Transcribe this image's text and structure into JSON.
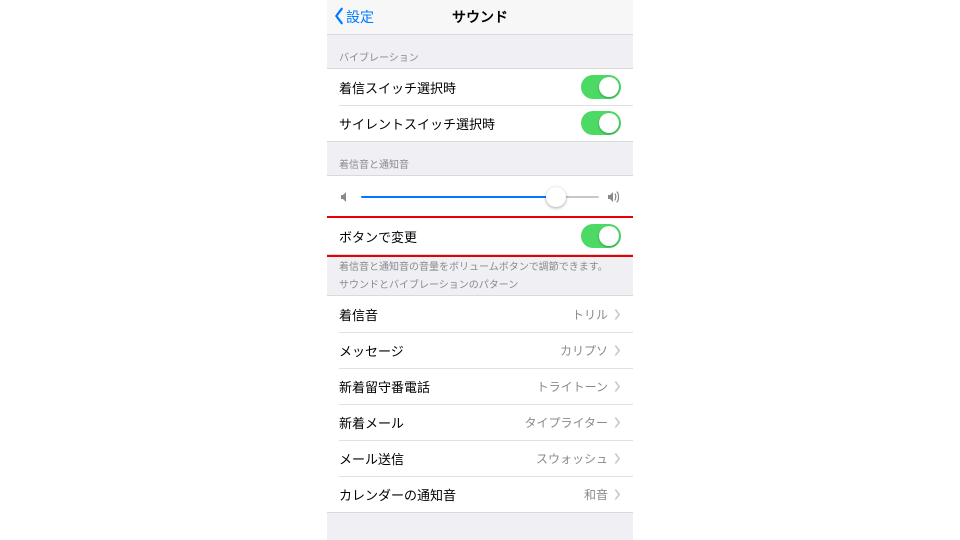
{
  "nav": {
    "back": "設定",
    "title": "サウンド"
  },
  "sections": {
    "vibration": {
      "header": "バイブレーション",
      "ring_switch": "着信スイッチ選択時",
      "silent_switch": "サイレントスイッチ選択時"
    },
    "ringer": {
      "header": "着信音と通知音",
      "change_with_buttons": "ボタンで変更",
      "footer": "着信音と通知音の音量をボリュームボタンで調節できます。",
      "volume_percent": 82
    },
    "patterns": {
      "header": "サウンドとバイブレーションのパターン",
      "items": [
        {
          "label": "着信音",
          "value": "トリル"
        },
        {
          "label": "メッセージ",
          "value": "カリプソ"
        },
        {
          "label": "新着留守番電話",
          "value": "トライトーン"
        },
        {
          "label": "新着メール",
          "value": "タイプライター"
        },
        {
          "label": "メール送信",
          "value": "スウォッシュ"
        },
        {
          "label": "カレンダーの通知音",
          "value": "和音"
        }
      ]
    }
  },
  "toggles": {
    "ring_switch": true,
    "silent_switch": true,
    "change_with_buttons": true
  },
  "highlight": {
    "row": "change_with_buttons"
  }
}
